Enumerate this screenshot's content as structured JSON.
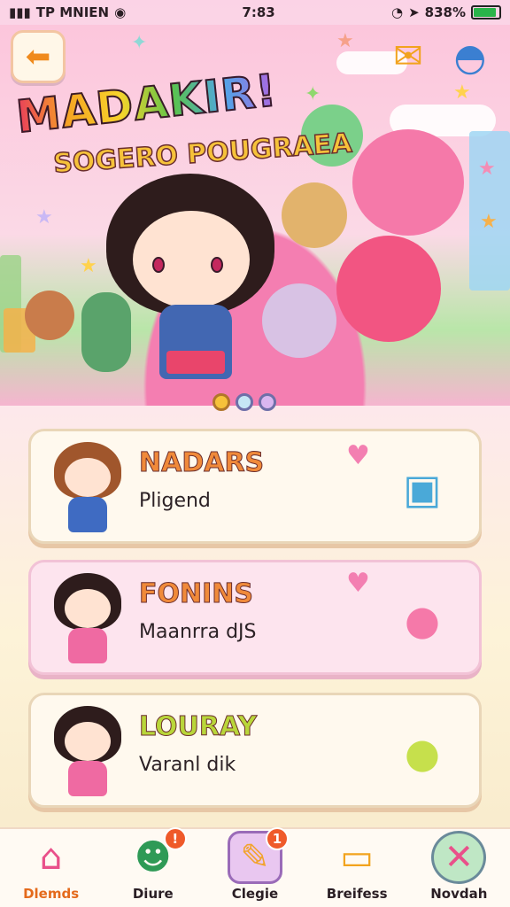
{
  "status_bar": {
    "carrier": "TP MNIEN",
    "time": "7:83",
    "battery_percent": "838%",
    "battery_level": 0.9
  },
  "header": {
    "back_icon": "arrow-left-icon",
    "mail_icon": "envelope-icon",
    "helmet_icon": "helmet-icon"
  },
  "hero": {
    "title": "MADAKIR!",
    "subtitle": "SOGERO POUGRAEA",
    "pager_count": 3,
    "pager_active": 0
  },
  "cards": [
    {
      "title": "NADARS",
      "subtitle": "Pligend",
      "title_color": "#f08a3a"
    },
    {
      "title": "FONINS",
      "subtitle": "Maanrra dJS",
      "title_color": "#f08a3a"
    },
    {
      "title": "LOURAY",
      "subtitle": "Varanl dik",
      "title_color": "#b9d63a"
    }
  ],
  "bottom_nav": [
    {
      "label": "Dlemds",
      "icon": "house-icon",
      "badge": ""
    },
    {
      "label": "Diure",
      "icon": "character-icon",
      "badge": "!"
    },
    {
      "label": "Clegie",
      "icon": "brush-icon",
      "badge": "1"
    },
    {
      "label": "Breifess",
      "icon": "computer-icon",
      "badge": ""
    },
    {
      "label": "Novdah",
      "icon": "close-circle-icon",
      "badge": ""
    }
  ],
  "colors": {
    "accent_orange": "#f08a1c",
    "accent_pink": "#f37fb1",
    "badge": "#ef5a2a"
  }
}
